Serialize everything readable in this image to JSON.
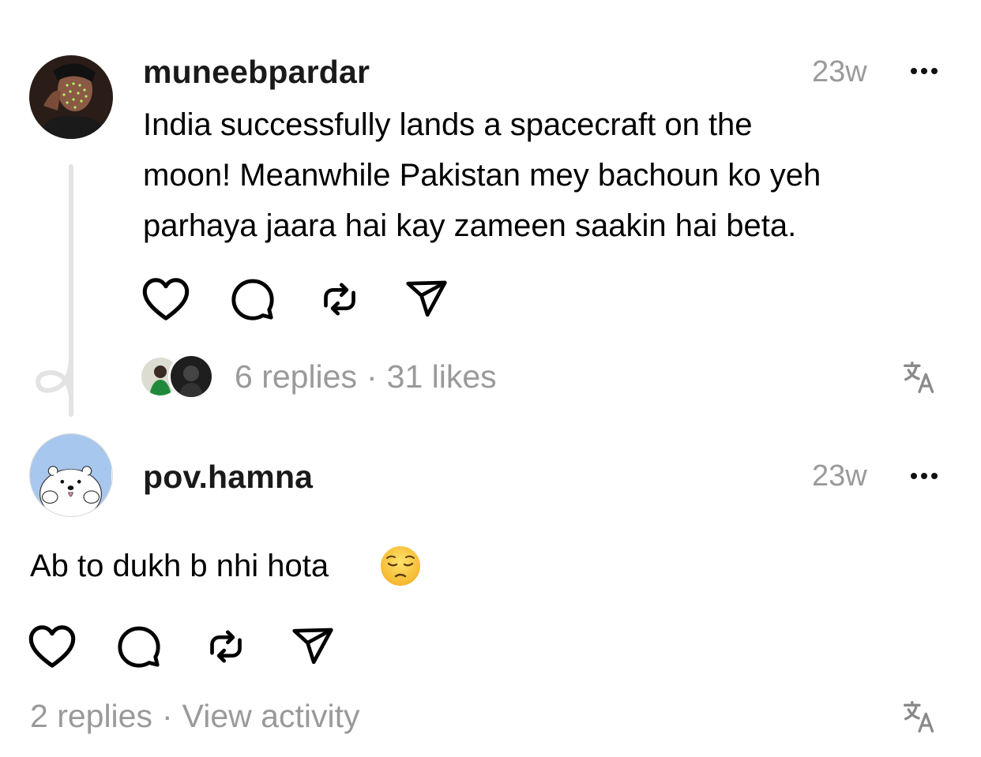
{
  "post": {
    "username": "muneebpardar",
    "time": "23w",
    "text_lines": [
      "India successfully lands a spacecraft on the",
      "moon! Meanwhile Pakistan mey bachoun ko yeh",
      "parhaya jaara hai kay zameen saakin hai beta."
    ],
    "replies": "6 replies",
    "separator": "·",
    "likes": "31 likes",
    "translate_icon": "translate-icon",
    "actions": [
      "like-icon",
      "comment-icon",
      "repost-icon",
      "share-icon"
    ]
  },
  "reply": {
    "username": "pov.hamna",
    "time": "23w",
    "text": "Ab to dukh b nhi hota",
    "emoji": "😔",
    "replies": "2 replies",
    "separator": "·",
    "view_activity": "View activity",
    "translate_icon": "translate-icon",
    "actions": [
      "like-icon",
      "comment-icon",
      "repost-icon",
      "share-icon"
    ]
  },
  "colors": {
    "text": "#000000",
    "secondary": "#9a9a9a",
    "thread_line": "#e3e3e3",
    "reply_avatar_bg": "#a7c7ee"
  }
}
